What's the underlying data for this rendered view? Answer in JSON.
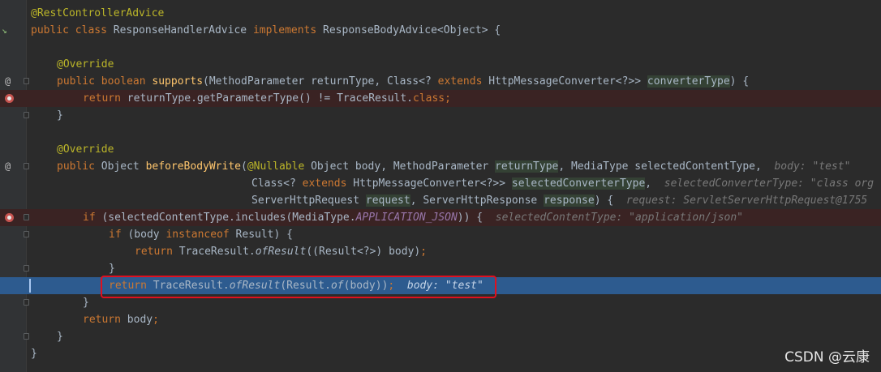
{
  "editor": {
    "lines": [
      [
        [
          "@RestControllerAdvice",
          "ann"
        ]
      ],
      [
        [
          "public class ",
          "kw"
        ],
        [
          "ResponseHandlerAdvice ",
          ""
        ],
        [
          "implements ",
          "kw"
        ],
        [
          "ResponseBodyAdvice<Object> {",
          ""
        ]
      ],
      [],
      [
        [
          "@Override",
          "ann"
        ]
      ],
      [
        [
          "public boolean ",
          "kw"
        ],
        [
          "supports",
          "fn"
        ],
        [
          "(MethodParameter returnType, Class<? ",
          ""
        ],
        [
          "extends ",
          "kw"
        ],
        [
          "HttpMessageConverter<?>> ",
          ""
        ],
        [
          "converterType",
          "hl"
        ],
        [
          ") {",
          ""
        ]
      ],
      [
        [
          "return ",
          "kw"
        ],
        [
          "returnType.getParameterType() != TraceResult.",
          ""
        ],
        [
          "class",
          "kw"
        ],
        [
          ";",
          "kw"
        ]
      ],
      [
        [
          "}",
          ""
        ]
      ],
      [],
      [
        [
          "@Override",
          "ann"
        ]
      ],
      [
        [
          "public ",
          "kw"
        ],
        [
          "Object ",
          ""
        ],
        [
          "beforeBodyWrite",
          "fn"
        ],
        [
          "(",
          ""
        ],
        [
          "@Nullable ",
          "ann"
        ],
        [
          "Object body, MethodParameter ",
          ""
        ],
        [
          "returnType",
          "hl"
        ],
        [
          ", MediaType selectedContentType,  ",
          ""
        ],
        [
          "body: \"test\"",
          "hint"
        ]
      ],
      [
        [
          "Class<? ",
          ""
        ],
        [
          "extends ",
          "kw"
        ],
        [
          "HttpMessageConverter<?>> ",
          ""
        ],
        [
          "selectedConverterType",
          "hl"
        ],
        [
          ",  ",
          ""
        ],
        [
          "selectedConverterType: \"class org",
          "hint"
        ]
      ],
      [
        [
          "ServerHttpRequest ",
          ""
        ],
        [
          "request",
          "hl"
        ],
        [
          ", ServerHttpResponse ",
          ""
        ],
        [
          "response",
          "hl"
        ],
        [
          ") {  ",
          ""
        ],
        [
          "request: ServletServerHttpRequest@1755",
          "hint"
        ]
      ],
      [
        [
          "if ",
          "kw"
        ],
        [
          "(selectedContentType.includes(MediaType.",
          ""
        ],
        [
          "APPLICATION_JSON",
          "static-i"
        ],
        [
          ")) {  ",
          ""
        ],
        [
          "selectedContentType: \"application/json\"",
          "hint"
        ]
      ],
      [
        [
          "if ",
          "kw"
        ],
        [
          "(body ",
          ""
        ],
        [
          "instanceof ",
          "kw"
        ],
        [
          "Result) {",
          ""
        ]
      ],
      [
        [
          "return ",
          "kw"
        ],
        [
          "TraceResult.",
          ""
        ],
        [
          "ofResult",
          "sfn"
        ],
        [
          "((Result<?>) body)",
          ""
        ],
        [
          ";",
          "kw"
        ]
      ],
      [
        [
          "}",
          ""
        ]
      ],
      [
        [
          "return ",
          "kw"
        ],
        [
          "TraceResult.",
          ""
        ],
        [
          "ofResult",
          "sfn"
        ],
        [
          "(Result.",
          ""
        ],
        [
          "of",
          "sfn"
        ],
        [
          "(body))",
          ""
        ],
        [
          ";  ",
          "kw"
        ],
        [
          "body: \"test\"",
          "hint-cur"
        ]
      ],
      [
        [
          "}",
          ""
        ]
      ],
      [
        [
          "return ",
          "kw"
        ],
        [
          "body",
          ""
        ],
        [
          ";",
          "kw"
        ]
      ],
      [
        [
          "}",
          ""
        ]
      ],
      [
        [
          "}",
          ""
        ]
      ]
    ]
  },
  "watermark": "CSDN @云康",
  "colors": {
    "background": "#2b2b2b",
    "keyword": "#cc7832",
    "annotation": "#bbb529",
    "method": "#ffc66d",
    "current_line": "#2d5b8f",
    "breakpoint": "#c75450",
    "highlight_box": "#e0101f"
  }
}
